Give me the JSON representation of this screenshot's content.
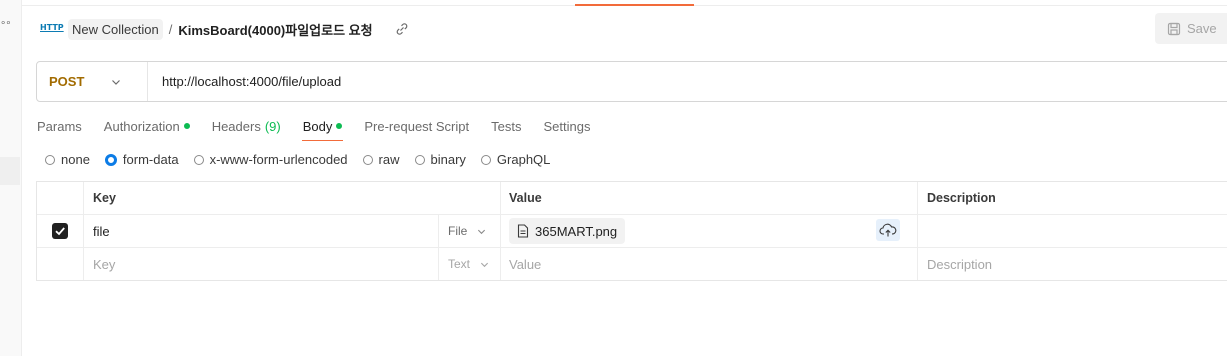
{
  "window": {
    "rail_icon_text": "∘∘"
  },
  "header": {
    "http_icon_text": "HTTP",
    "collection": "New Collection",
    "separator": "/",
    "request_title": "KimsBoard(4000)파일업로드 요청",
    "save_label": "Save"
  },
  "request": {
    "method": "POST",
    "url": "http://localhost:4000/file/upload"
  },
  "tabs": [
    {
      "label": "Params"
    },
    {
      "label": "Authorization"
    },
    {
      "label": "Headers",
      "count": "(9)"
    },
    {
      "label": "Body"
    },
    {
      "label": "Pre-request Script"
    },
    {
      "label": "Tests"
    },
    {
      "label": "Settings"
    }
  ],
  "body_types": [
    {
      "label": "none",
      "checked": false
    },
    {
      "label": "form-data",
      "checked": true
    },
    {
      "label": "x-www-form-urlencoded",
      "checked": false
    },
    {
      "label": "raw",
      "checked": false
    },
    {
      "label": "binary",
      "checked": false
    },
    {
      "label": "GraphQL",
      "checked": false
    }
  ],
  "table": {
    "headers": {
      "key": "Key",
      "value": "Value",
      "description": "Description"
    },
    "rows": [
      {
        "key": "file",
        "type": "File",
        "value": "365MART.png",
        "description": "",
        "checked": true
      }
    ],
    "new_row": {
      "key_placeholder": "Key",
      "type": "Text",
      "value_placeholder": "Value",
      "description_placeholder": "Description"
    }
  },
  "colors": {
    "accent": "#f26b3a",
    "method": "#a26b00",
    "indicator": "#0cbb52",
    "radio": "#0c7ce6"
  }
}
